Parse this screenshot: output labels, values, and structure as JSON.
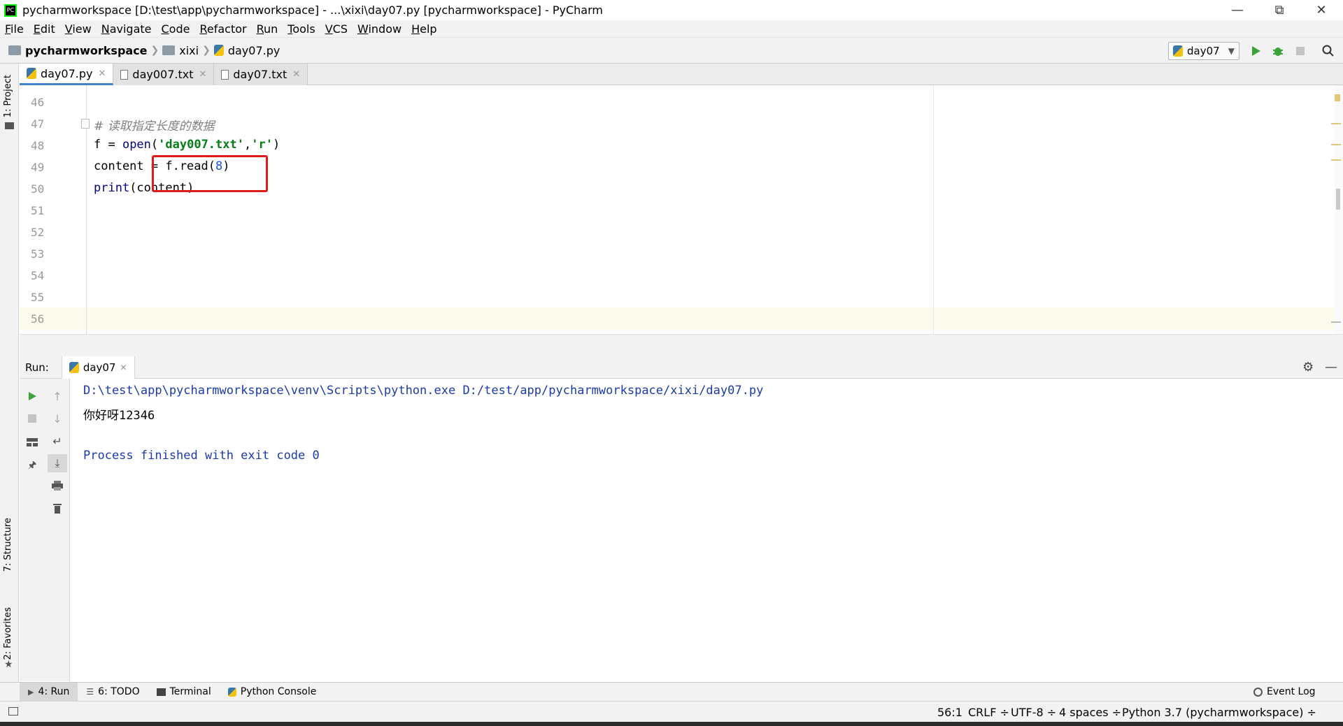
{
  "window": {
    "title": "pycharmworkspace [D:\\test\\app\\pycharmworkspace] - ...\\xixi\\day07.py [pycharmworkspace] - PyCharm",
    "app_icon_text": "PC"
  },
  "menu": [
    "File",
    "Edit",
    "View",
    "Navigate",
    "Code",
    "Refactor",
    "Run",
    "Tools",
    "VCS",
    "Window",
    "Help"
  ],
  "breadcrumb": [
    "pycharmworkspace",
    "xixi",
    "day07.py"
  ],
  "toolbar": {
    "run_config": "day07"
  },
  "left_tool_windows": [
    "1: Project",
    "7: Structure",
    "2: Favorites"
  ],
  "editor_tabs": [
    {
      "label": "day07.py",
      "active": true
    },
    {
      "label": "day007.txt",
      "active": false
    },
    {
      "label": "day07.txt",
      "active": false
    }
  ],
  "line_numbers": [
    "46",
    "47",
    "48",
    "49",
    "50",
    "51",
    "52",
    "53",
    "54",
    "55",
    "56"
  ],
  "code": {
    "comment": "# 读取指定长度的数据",
    "l48_a": "f = ",
    "l48_open": "open",
    "l48_p1": "(",
    "l48_s1": "'day007.txt'",
    "l48_comma": ",",
    "l48_s2": "'r'",
    "l48_p2": ")",
    "l49_a": "content = f.read(",
    "l49_num": "8",
    "l49_b": ")",
    "l50_print": "print",
    "l50_b": "(content)"
  },
  "run_panel": {
    "label": "Run:",
    "tab": "day07",
    "output": [
      "D:\\test\\app\\pycharmworkspace\\venv\\Scripts\\python.exe D:/test/app/pycharmworkspace/xixi/day07.py",
      "你好呀12346",
      "",
      "Process finished with exit code 0"
    ]
  },
  "bottom_tabs": [
    "4: Run",
    "6: TODO",
    "Terminal",
    "Python Console",
    "Event Log"
  ],
  "status": {
    "position": "56:1",
    "line_sep": "CRLF ÷",
    "encoding": "UTF-8 ÷",
    "indent": "4 spaces ÷",
    "interpreter": "Python 3.7 (pycharmworkspace) ÷"
  },
  "colors": {
    "accent_blue": "#4083c9",
    "highlight_red": "#e01b1b",
    "string_green": "#067d17",
    "output_blue": "#1c3aa9"
  }
}
